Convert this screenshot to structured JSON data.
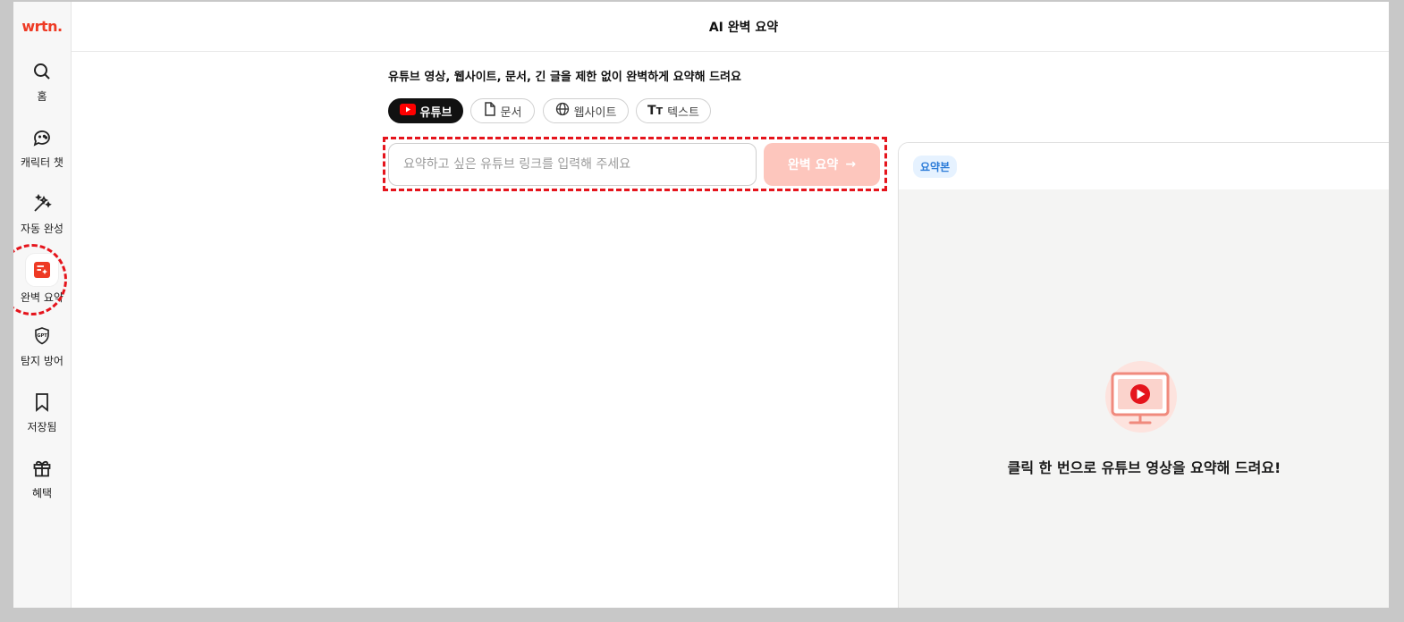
{
  "app": {
    "logo_text": "wrtn.",
    "brand_color": "#ee3a24"
  },
  "sidebar": {
    "items": [
      {
        "label": "홈",
        "icon": "search-icon"
      },
      {
        "label": "캐릭터 챗",
        "icon": "gamepad-chat-icon"
      },
      {
        "label": "자동 완성",
        "icon": "magic-wand-icon"
      },
      {
        "label": "완벽 요약",
        "icon": "summary-icon",
        "active": true
      },
      {
        "label": "탐지 방어",
        "icon": "gpt-shield-icon"
      },
      {
        "label": "저장됨",
        "icon": "bookmark-icon"
      },
      {
        "label": "혜택",
        "icon": "gift-icon"
      }
    ]
  },
  "header": {
    "title": "AI 완벽 요약"
  },
  "main": {
    "subtitle": "유튜브 영상, 웹사이트, 문서, 긴 글을 제한 없이 완벽하게 요약해 드려요",
    "tabs": [
      {
        "label": "유튜브",
        "icon": "youtube-icon",
        "active": true
      },
      {
        "label": "문서",
        "icon": "document-icon"
      },
      {
        "label": "웹사이트",
        "icon": "globe-icon"
      },
      {
        "label": "텍스트",
        "icon": "text-icon"
      }
    ],
    "input": {
      "placeholder": "요약하고 싶은 유튜브 링크를 입력해 주세요",
      "value": ""
    },
    "submit_label": "완벽 요약",
    "submit_arrow": "→"
  },
  "panel": {
    "badge": "요약본",
    "empty_message": "클릭 한 번으로 유튜브 영상을 요약해 드려요!"
  },
  "colors": {
    "highlight_dash": "#e5141c",
    "button_disabled": "#fdc6bd",
    "badge_bg": "#e6f2ff",
    "badge_text": "#2b7bd8"
  }
}
